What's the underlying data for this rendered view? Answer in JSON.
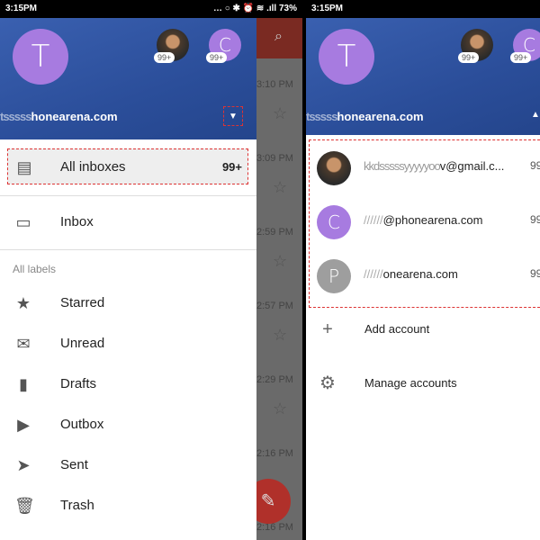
{
  "status": {
    "time": "3:15PM",
    "icons": "… ○ ✱ ⏰ ≋ .ıll",
    "battery": "73%"
  },
  "left": {
    "avatar_main": "T",
    "avatar_second": "C",
    "badge1": "99+",
    "badge2": "99+",
    "email_hidden": "tsssss",
    "email_visible": "honearena.com",
    "all_inboxes": {
      "label": "All inboxes",
      "count": "99+"
    },
    "inbox": "Inbox",
    "labels_heading": "All labels",
    "labels": [
      "Starred",
      "Unread",
      "Drafts",
      "Outbox",
      "Sent",
      "Trash"
    ],
    "times": [
      "3:10 PM",
      "3:09 PM",
      "2:59 PM",
      "2:57 PM",
      "2:29 PM",
      "2:16 PM",
      "2:16 PM"
    ]
  },
  "right": {
    "avatar_main": "T",
    "avatar_second": "C",
    "badge1": "99+",
    "badge2": "99+",
    "email_hidden": "tsssss",
    "email_visible": "honearena.com",
    "accounts": [
      {
        "initial": "",
        "hidden": "kkdsssssyyyyyoo",
        "email": "v@gmail.c...",
        "count": "99"
      },
      {
        "initial": "C",
        "hidden": "//////",
        "email": "@phonearena.com",
        "count": "99"
      },
      {
        "initial": "P",
        "hidden": "//////",
        "email": "onearena.com",
        "count": "99"
      }
    ],
    "add_account": "Add account",
    "manage_accounts": "Manage accounts"
  },
  "colors": {
    "header": "#2b4e9a",
    "avatar_purple": "#a77be0",
    "avatar_grey": "#9e9e9e",
    "fab": "#b0302a",
    "highlight_box": "#dd3333"
  }
}
